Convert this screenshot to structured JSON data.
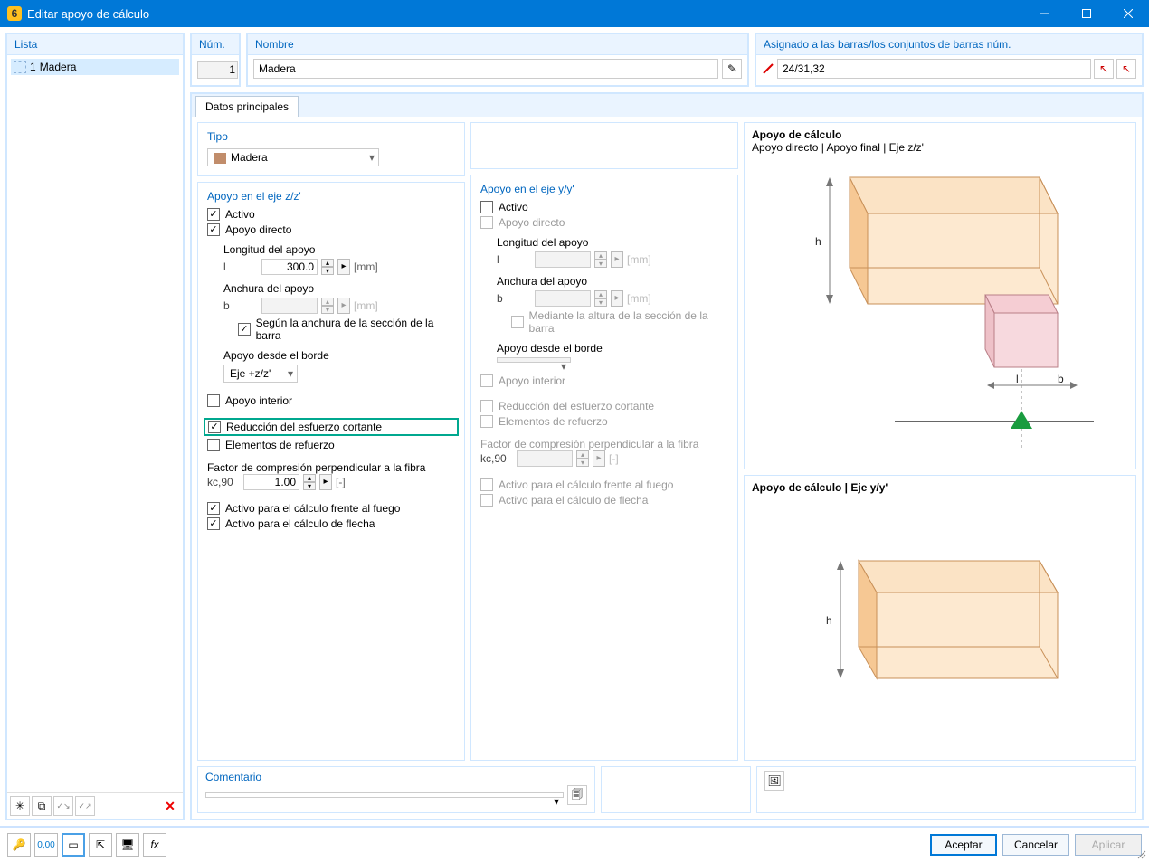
{
  "window": {
    "title": "Editar apoyo de cálculo"
  },
  "list": {
    "header": "Lista",
    "items": [
      {
        "num": "1",
        "name": "Madera"
      }
    ]
  },
  "header_fields": {
    "num_label": "Núm.",
    "num_value": "1",
    "name_label": "Nombre",
    "name_value": "Madera",
    "assign_label": "Asignado a las barras/los conjuntos de barras núm.",
    "assign_value": "24/31,32"
  },
  "tabs": {
    "main": "Datos principales"
  },
  "tipo": {
    "title": "Tipo",
    "value": "Madera"
  },
  "zz": {
    "title": "Apoyo en el eje z/z'",
    "active": {
      "label": "Activo",
      "checked": true
    },
    "direct": {
      "label": "Apoyo directo",
      "checked": true
    },
    "length_label": "Longitud del apoyo",
    "length_sym": "l",
    "length_value": "300.0",
    "length_unit": "[mm]",
    "width_label": "Anchura del apoyo",
    "width_sym": "b",
    "width_value": "",
    "width_unit": "[mm]",
    "width_opt": {
      "label": "Según la anchura de la sección de la barra",
      "checked": true
    },
    "edge_label": "Apoyo desde el borde",
    "edge_value": "Eje +z/z'",
    "inner": {
      "label": "Apoyo interior",
      "checked": false
    },
    "shear": {
      "label": "Reducción del esfuerzo cortante",
      "checked": true
    },
    "reinf": {
      "label": "Elementos de refuerzo",
      "checked": false
    },
    "kc_label": "Factor de compresión perpendicular a la fibra",
    "kc_sym": "kc,90",
    "kc_value": "1.00",
    "kc_unit": "[-]",
    "fire": {
      "label": "Activo para el cálculo frente al fuego",
      "checked": true
    },
    "defl": {
      "label": "Activo para el cálculo de flecha",
      "checked": true
    }
  },
  "yy": {
    "title": "Apoyo en el eje y/y'",
    "active": {
      "label": "Activo",
      "checked": false
    },
    "direct": {
      "label": "Apoyo directo",
      "checked": false
    },
    "length_label": "Longitud del apoyo",
    "length_sym": "l",
    "length_unit": "[mm]",
    "width_label": "Anchura del apoyo",
    "width_sym": "b",
    "width_unit": "[mm]",
    "width_opt": {
      "label": "Mediante la altura de la sección de la barra",
      "checked": false
    },
    "edge_label": "Apoyo desde el borde",
    "inner": {
      "label": "Apoyo interior",
      "checked": false
    },
    "shear": {
      "label": "Reducción del esfuerzo cortante",
      "checked": false
    },
    "reinf": {
      "label": "Elementos de refuerzo",
      "checked": false
    },
    "kc_label": "Factor de compresión perpendicular a la fibra",
    "kc_sym": "kc,90",
    "kc_unit": "[-]",
    "fire": {
      "label": "Activo para el cálculo frente al fuego",
      "checked": false
    },
    "defl": {
      "label": "Activo para el cálculo de flecha",
      "checked": false
    }
  },
  "preview": {
    "zz_title": "Apoyo de cálculo",
    "zz_sub": "Apoyo directo | Apoyo final | Eje z/z'",
    "yy_title": "Apoyo de cálculo | Eje y/y'",
    "h_sym": "h",
    "l_sym": "l",
    "b_sym": "b"
  },
  "comment": {
    "label": "Comentario"
  },
  "buttons": {
    "ok": "Aceptar",
    "cancel": "Cancelar",
    "apply": "Aplicar"
  }
}
